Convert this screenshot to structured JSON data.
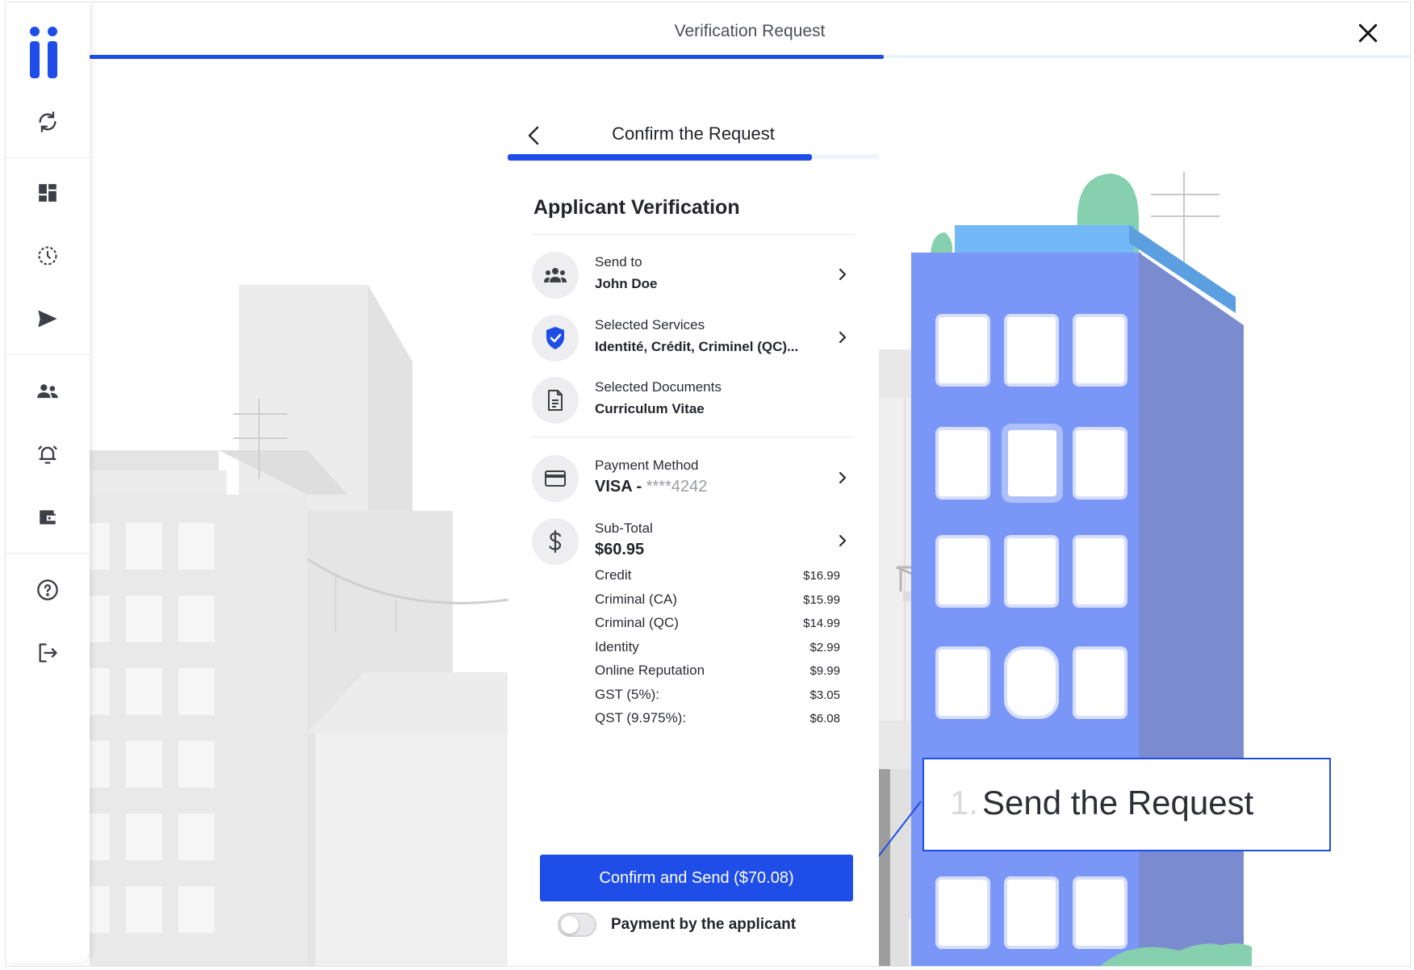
{
  "header": {
    "title": "Verification Request",
    "progress": 0.6
  },
  "sidebar": {
    "items": [
      {
        "icon": "refresh-icon"
      },
      {
        "icon": "dashboard-icon"
      },
      {
        "icon": "history-icon"
      },
      {
        "icon": "send-icon"
      },
      {
        "icon": "users-icon"
      },
      {
        "icon": "alarm-icon"
      },
      {
        "icon": "wallet-icon"
      },
      {
        "icon": "help-icon"
      },
      {
        "icon": "logout-icon"
      }
    ]
  },
  "panel": {
    "title": "Confirm the Request",
    "progress": 0.82,
    "heading": "Applicant Verification",
    "send_to": {
      "label": "Send to",
      "value": "John Doe"
    },
    "services": {
      "label": "Selected Services",
      "value": "Identité, Crédit, Criminel (QC)..."
    },
    "documents": {
      "label": "Selected Documents",
      "value": "Curriculum Vitae"
    },
    "payment": {
      "label": "Payment Method",
      "brand": "VISA - ",
      "masked": "****4242"
    },
    "subtotal": {
      "label": "Sub-Total",
      "value": "$60.95"
    },
    "fees": [
      {
        "name": "Credit",
        "amount": "$16.99"
      },
      {
        "name": "Criminal (CA)",
        "amount": "$15.99"
      },
      {
        "name": "Criminal (QC)",
        "amount": "$14.99"
      },
      {
        "name": "Identity",
        "amount": "$2.99"
      },
      {
        "name": "Online Reputation",
        "amount": "$9.99"
      },
      {
        "name": "GST (5%):",
        "amount": "$3.05"
      },
      {
        "name": "QST (9.975%):",
        "amount": "$6.08"
      }
    ],
    "confirm_button": "Confirm and Send ($70.08)",
    "toggle": {
      "label": "Payment by the applicant",
      "on": false
    }
  },
  "callout": {
    "number": "1.",
    "text": "Send the Request"
  },
  "colors": {
    "accent": "#1f4de8",
    "building": "#7a96f6",
    "plant": "#86d0b0"
  }
}
